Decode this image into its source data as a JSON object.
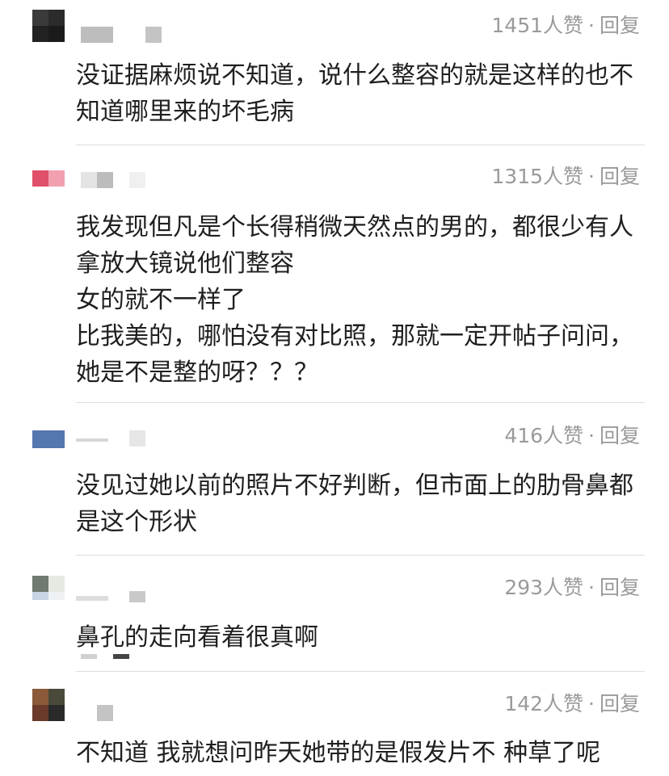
{
  "comments": [
    {
      "likes": "1451人赞",
      "separator": "·",
      "reply": "回复",
      "avatar_colors": [
        "#3a3a3a",
        "#2b2b2b",
        "#222222",
        "#1b1b1b"
      ],
      "lines": [
        "没证据麻烦说不知道，说什么整容的就是这样的也不",
        "知道哪里来的坏毛病"
      ]
    },
    {
      "likes": "1315人赞",
      "separator": "·",
      "reply": "回复",
      "avatar_colors": [
        "#e0506a",
        "#f2a0b0",
        "#ffffff",
        "#ffffff"
      ],
      "lines": [
        "我发现但凡是个长得稍微天然点的男的，都很少有人",
        "拿放大镜说他们整容",
        "女的就不一样了",
        "比我美的，哪怕没有对比照，那就一定开帖子问问，",
        "她是不是整的呀？？？"
      ]
    },
    {
      "likes": "416人赞",
      "separator": "·",
      "reply": "回复",
      "avatar_colors": [
        "#ffffff",
        "#ffffff",
        "#4a6fa8",
        "#6b8cc0"
      ],
      "lines": [
        "没见过她以前的照片不好判断，但市面上的肋骨鼻都",
        "是这个形状"
      ]
    },
    {
      "likes": "293人赞",
      "separator": "·",
      "reply": "回复",
      "avatar_colors": [
        "#707a70",
        "#e6e9e2",
        "#c8d4e4",
        "#eef1f4"
      ],
      "lines": [
        "鼻孔的走向看着很真啊"
      ]
    },
    {
      "likes": "142人赞",
      "separator": "·",
      "reply": "回复",
      "avatar_colors": [
        "#8a5a3a",
        "#4a4a3a",
        "#6a3a2a",
        "#2a2a2a"
      ],
      "lines": [
        "不知道 我就想问昨天她带的是假发片不 种草了呢"
      ]
    }
  ]
}
